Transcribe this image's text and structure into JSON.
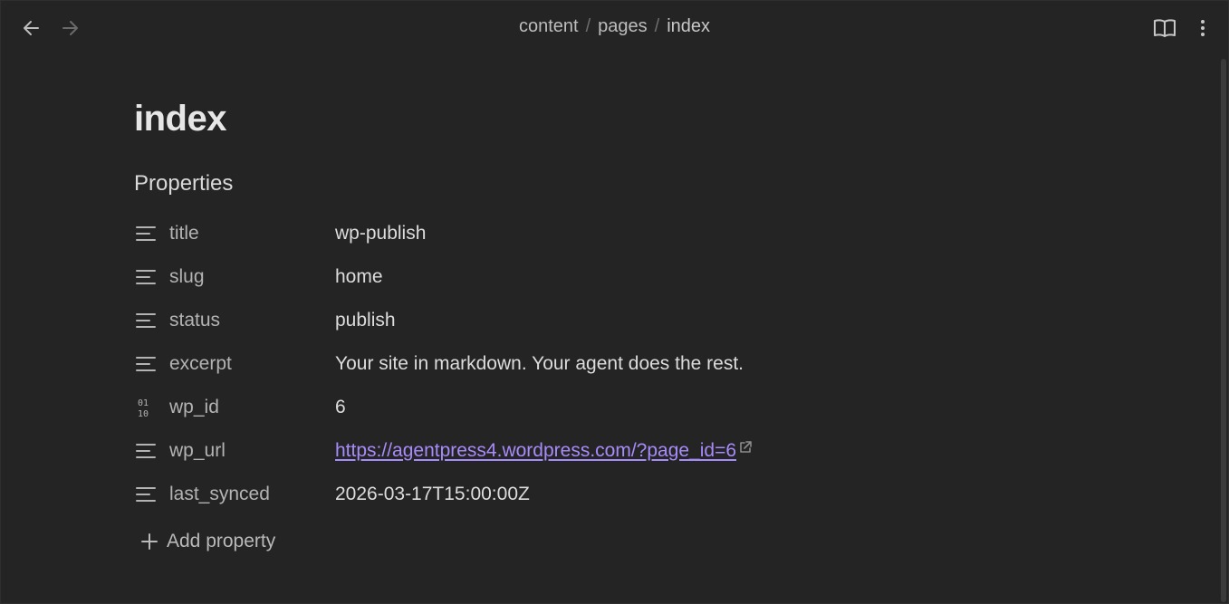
{
  "breadcrumb": {
    "items": [
      "content",
      "pages",
      "index"
    ],
    "separator": "/"
  },
  "page": {
    "title": "index"
  },
  "properties": {
    "heading": "Properties",
    "rows": [
      {
        "key": "title",
        "value": "wp-publish",
        "icon": "text-lines-icon"
      },
      {
        "key": "slug",
        "value": "home",
        "icon": "text-lines-icon"
      },
      {
        "key": "status",
        "value": "publish",
        "icon": "text-lines-icon"
      },
      {
        "key": "excerpt",
        "value": "Your site in markdown. Your agent does the rest.",
        "icon": "text-lines-icon"
      },
      {
        "key": "wp_id",
        "value": "6",
        "icon": "number-icon"
      },
      {
        "key": "wp_url",
        "value": "https://agentpress4.wordpress.com/?page_id=6",
        "icon": "text-lines-icon"
      },
      {
        "key": "last_synced",
        "value": "2026-03-17T15:00:00Z",
        "icon": "text-lines-icon"
      }
    ],
    "add_label": "Add property"
  },
  "colors": {
    "background": "#242424",
    "link": "#a88bfa",
    "muted_text": "#b3b3b3"
  }
}
